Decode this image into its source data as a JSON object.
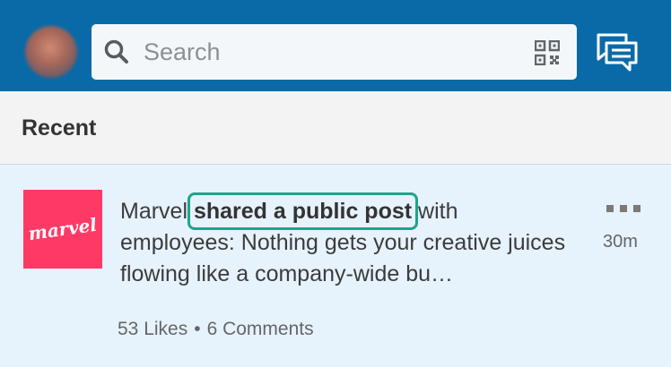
{
  "header": {
    "search": {
      "placeholder": "Search"
    },
    "icons": {
      "search": "search-icon",
      "qr": "qr-code-icon",
      "messaging": "messaging-icon"
    },
    "background_color": "#0a6aa8"
  },
  "section": {
    "title": "Recent"
  },
  "feed_item": {
    "actor": "Marvel",
    "action": "shared a public post",
    "text_after": " with employees: Nothing gets your creative juices flowing like a company-wide bu…",
    "timestamp": "30m",
    "likes": "53 Likes",
    "separator": "•",
    "comments": "6 Comments",
    "logo_text": "marvel",
    "logo_color": "#ff3966",
    "highlight_color": "#1aa68a"
  }
}
